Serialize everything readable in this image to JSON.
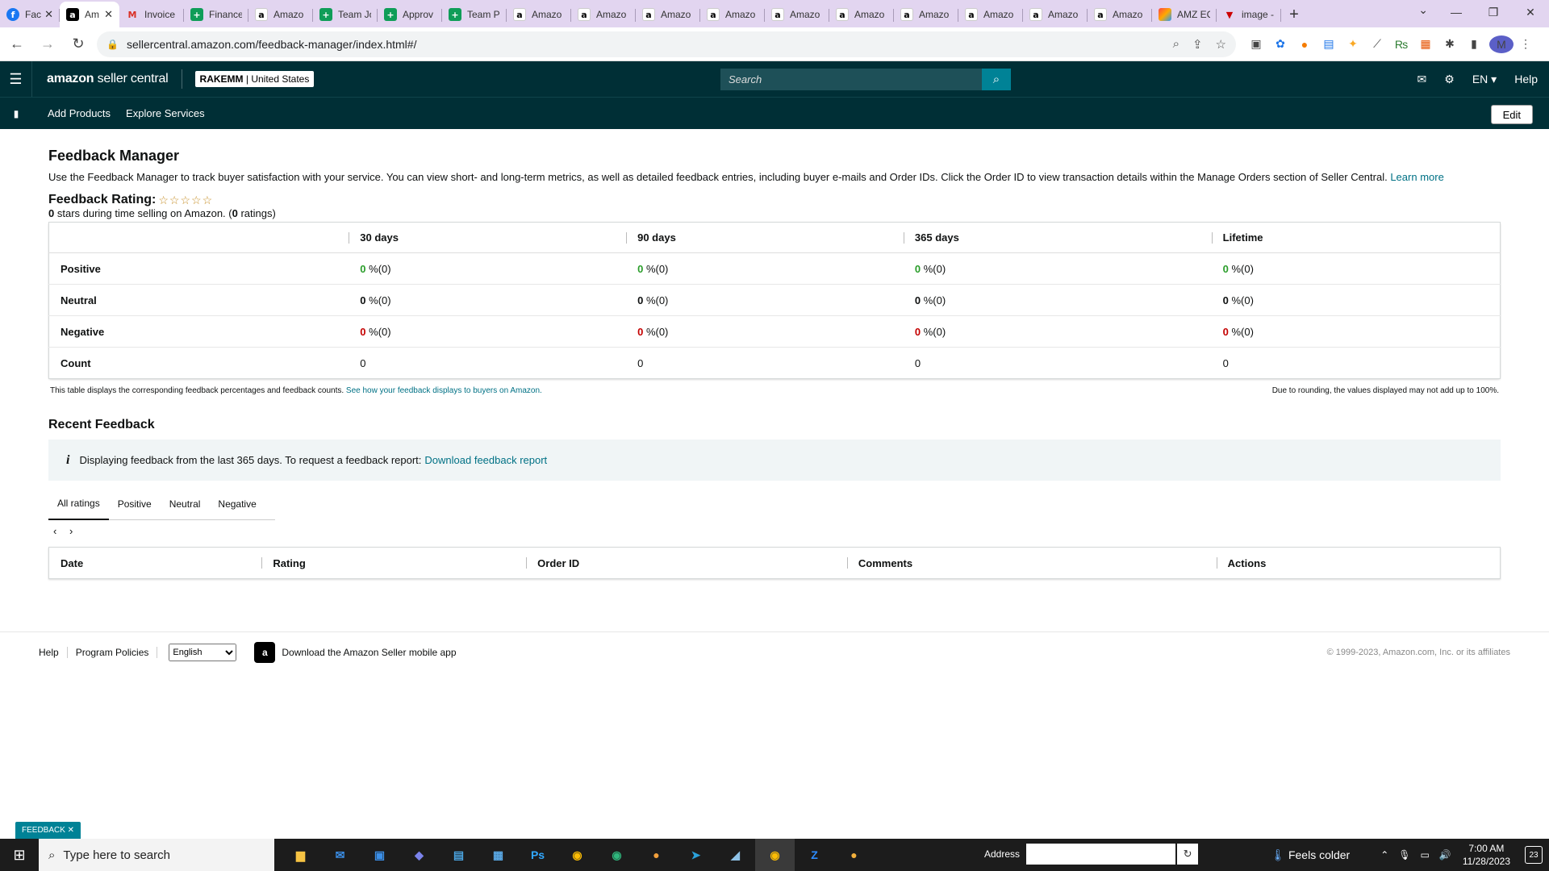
{
  "browser": {
    "tabs": [
      {
        "label": "Fac",
        "icon": "facebook-icon",
        "fav": "f",
        "cls": "fb",
        "active": false
      },
      {
        "label": "Am",
        "icon": "amazon-icon",
        "fav": "a",
        "cls": "amz",
        "active": true
      },
      {
        "label": "Invoice",
        "icon": "gmail-icon",
        "fav": "M",
        "cls": "gm",
        "active": false
      },
      {
        "label": "Finance",
        "icon": "sheets-icon",
        "fav": "+",
        "cls": "sh",
        "active": false
      },
      {
        "label": "Amazo",
        "icon": "amazon-icon",
        "fav": "a",
        "cls": "amzw",
        "active": false
      },
      {
        "label": "Team Jo",
        "icon": "sheets-icon",
        "fav": "+",
        "cls": "sh",
        "active": false
      },
      {
        "label": "Approv",
        "icon": "sheets-icon",
        "fav": "+",
        "cls": "sh",
        "active": false
      },
      {
        "label": "Team Pc",
        "icon": "sheets-icon",
        "fav": "+",
        "cls": "sh",
        "active": false
      },
      {
        "label": "Amazo",
        "icon": "amazon-icon",
        "fav": "a",
        "cls": "amzw",
        "active": false
      },
      {
        "label": "Amazo",
        "icon": "amazon-icon",
        "fav": "a",
        "cls": "amzw",
        "active": false
      },
      {
        "label": "Amazo",
        "icon": "amazon-icon",
        "fav": "a",
        "cls": "amzw",
        "active": false
      },
      {
        "label": "Amazo",
        "icon": "amazon-icon",
        "fav": "a",
        "cls": "amzw",
        "active": false
      },
      {
        "label": "Amazo",
        "icon": "amazon-icon",
        "fav": "a",
        "cls": "amzw",
        "active": false
      },
      {
        "label": "Amazo",
        "icon": "amazon-icon",
        "fav": "a",
        "cls": "amzw",
        "active": false
      },
      {
        "label": "Amazo",
        "icon": "amazon-icon",
        "fav": "a",
        "cls": "amzw",
        "active": false
      },
      {
        "label": "Amazo",
        "icon": "amazon-icon",
        "fav": "a",
        "cls": "amzw",
        "active": false
      },
      {
        "label": "Amazo",
        "icon": "amazon-icon",
        "fav": "a",
        "cls": "amzw",
        "active": false
      },
      {
        "label": "Amazo",
        "icon": "amazon-icon",
        "fav": "a",
        "cls": "amzw",
        "active": false
      },
      {
        "label": "AMZ EC",
        "icon": "amz-ec-icon",
        "fav": "",
        "cls": "amzec",
        "active": false
      },
      {
        "label": "image -",
        "icon": "image-tab-icon",
        "fav": "▼",
        "cls": "img",
        "active": false
      }
    ],
    "url": "sellercentral.amazon.com/feedback-manager/index.html#/"
  },
  "header": {
    "logo_bold": "amazon",
    "logo_light": " seller central",
    "store_name": "RAKEMM",
    "store_region": " | United States",
    "search_placeholder": "Search",
    "lang": "EN ▾",
    "help": "Help"
  },
  "subnav": {
    "links": [
      "Add Products",
      "Explore Services"
    ],
    "edit": "Edit"
  },
  "main": {
    "title": "Feedback Manager",
    "description": "Use the Feedback Manager to track buyer satisfaction with your service. You can view short- and long-term metrics, as well as detailed feedback entries, including buyer e-mails and Order IDs. Click the Order ID to view transaction details within the Manage Orders section of Seller Central. ",
    "learn_more": "Learn more",
    "rating_label": "Feedback Rating:",
    "stars": "☆☆☆☆☆",
    "rating_stars": "0",
    "rating_mid": " stars during time selling on Amazon. (",
    "rating_count": "0",
    "rating_end": " ratings)",
    "table": {
      "headers": [
        "",
        "30 days",
        "90 days",
        "365 days",
        "Lifetime"
      ],
      "rows": [
        {
          "label": "Positive",
          "cls": "pos",
          "cells": [
            [
              "0",
              " %(0)"
            ],
            [
              "0",
              " %(0)"
            ],
            [
              "0",
              " %(0)"
            ],
            [
              "0",
              " %(0)"
            ]
          ]
        },
        {
          "label": "Neutral",
          "cls": "neu",
          "cells": [
            [
              "0",
              " %(0)"
            ],
            [
              "0",
              " %(0)"
            ],
            [
              "0",
              " %(0)"
            ],
            [
              "0",
              " %(0)"
            ]
          ]
        },
        {
          "label": "Negative",
          "cls": "neg",
          "cells": [
            [
              "0",
              " %(0)"
            ],
            [
              "0",
              " %(0)"
            ],
            [
              "0",
              " %(0)"
            ],
            [
              "0",
              " %(0)"
            ]
          ]
        },
        {
          "label": "Count",
          "cls": "",
          "cells": [
            [
              "",
              "0"
            ],
            [
              "",
              "0"
            ],
            [
              "",
              "0"
            ],
            [
              "",
              "0"
            ]
          ]
        }
      ]
    },
    "note_left": "This table displays the corresponding feedback percentages and feedback counts. ",
    "note_link": "See how your feedback displays to buyers on Amazon.",
    "note_right": "Due to rounding, the values displayed may not add up to 100%.",
    "recent_title": "Recent Feedback",
    "info_text": "Displaying feedback from the last 365 days. To request a feedback report: ",
    "info_link": "Download feedback report",
    "tabs": [
      "All ratings",
      "Positive",
      "Neutral",
      "Negative"
    ],
    "recent_headers": [
      "Date",
      "Rating",
      "Order ID",
      "Comments",
      "Actions"
    ]
  },
  "footer": {
    "links": [
      "Help",
      "Program Policies"
    ],
    "language": "English",
    "app_text": "Download the Amazon Seller mobile app",
    "copyright": "© 1999-2023, Amazon.com, Inc. or its affiliates"
  },
  "feedback_button": "FEEDBACK ✕",
  "taskbar": {
    "search_placeholder": "Type here to search",
    "address_label": "Address",
    "weather": "Feels colder",
    "time": "7:00 AM",
    "date": "11/28/2023",
    "notifications": "23"
  }
}
